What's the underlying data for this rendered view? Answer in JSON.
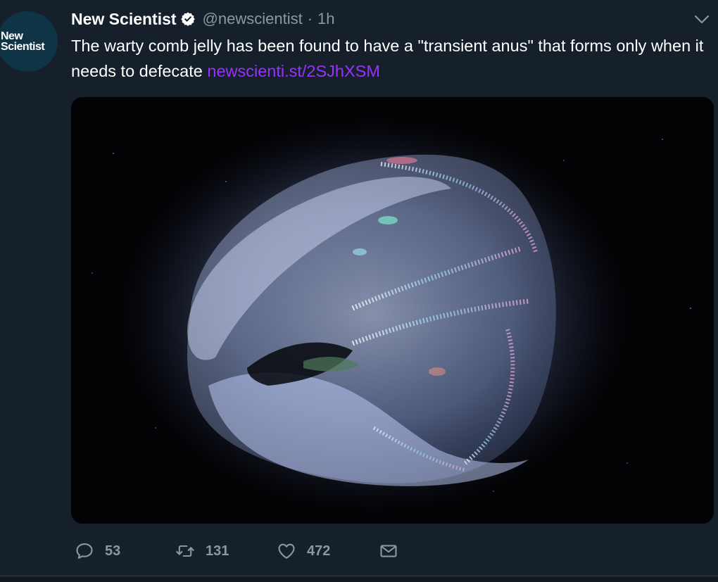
{
  "tweet": {
    "author_name": "New Scientist",
    "handle": "@newscientist",
    "separator": "·",
    "time": "1h",
    "text": "The warty comb jelly has been found to have a \"transient anus\" that forms only when it needs to defecate ",
    "link": "newscienti.st/2SJhXSM",
    "avatar": {
      "line1": "New",
      "line2": "Scientist"
    },
    "icons": {
      "verified": "verified-badge-icon",
      "menu": "chevron-down-icon",
      "reply": "reply-icon",
      "retweet": "retweet-icon",
      "like": "heart-icon",
      "dm": "envelope-icon"
    },
    "actions": {
      "replies": "53",
      "retweets": "131",
      "likes": "472"
    }
  },
  "colors": {
    "background": "#15202b",
    "secondary_text": "#8899a6",
    "link": "#9b30ff",
    "avatar_bg": "#0f3446"
  }
}
